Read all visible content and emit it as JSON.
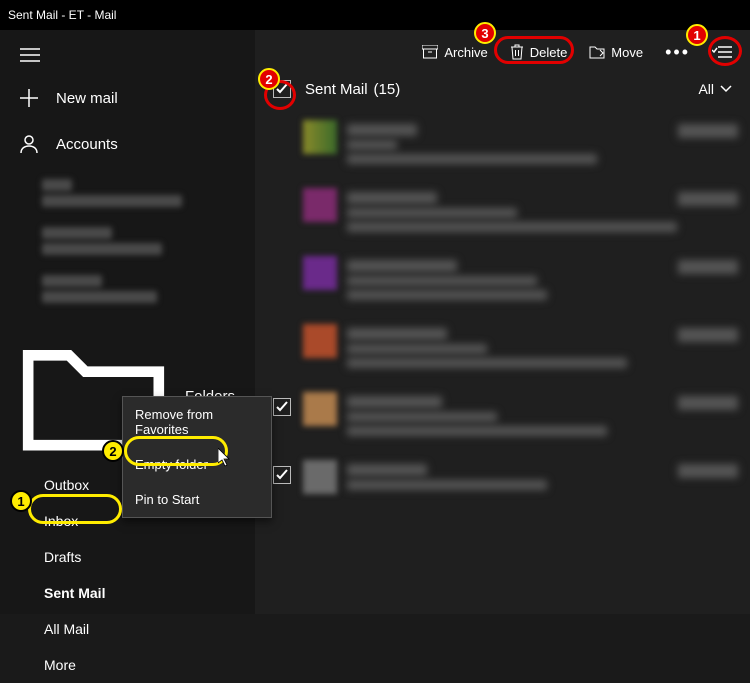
{
  "window": {
    "title": "Sent Mail - ET - Mail"
  },
  "sidebar": {
    "new_mail": "New mail",
    "accounts": "Accounts",
    "folders_label": "Folders",
    "items": [
      {
        "label": "Outbox"
      },
      {
        "label": "Inbox"
      },
      {
        "label": "Drafts"
      },
      {
        "label": "Sent Mail"
      },
      {
        "label": "All Mail"
      },
      {
        "label": "More"
      }
    ]
  },
  "toolbar": {
    "archive": "Archive",
    "delete": "Delete",
    "move": "Move"
  },
  "listheader": {
    "title": "Sent Mail",
    "count": "(15)",
    "filter": "All"
  },
  "context_menu": {
    "remove": "Remove from Favorites",
    "empty": "Empty folder",
    "pin": "Pin to Start"
  },
  "annotations": {
    "one": "1",
    "two": "2",
    "three": "3"
  }
}
